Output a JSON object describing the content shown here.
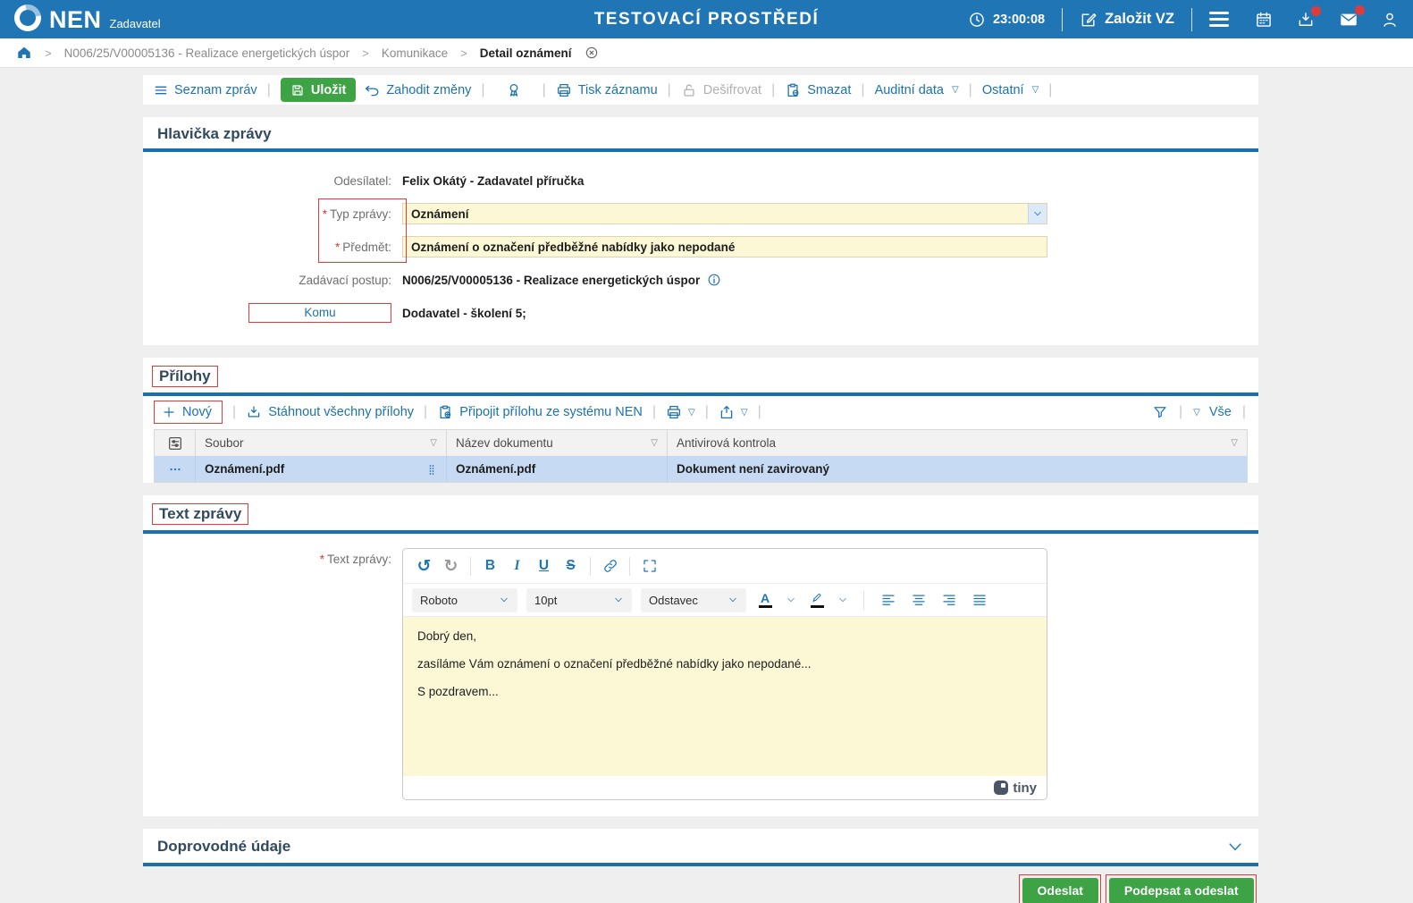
{
  "header": {
    "brand": "NEN",
    "brand_sub": "Zadavatel",
    "env": "TESTOVACÍ PROSTŘEDÍ",
    "time": "23:00:08",
    "zalozit": "Založit VZ"
  },
  "breadcrumb": {
    "item1": "N006/25/V00005136 - Realizace energetických úspor",
    "item2": "Komunikace",
    "item3": "Detail oznámení"
  },
  "toolbar": {
    "seznam": "Seznam zpráv",
    "ulozit": "Uložit",
    "zahodit": "Zahodit změny",
    "tisk": "Tisk záznamu",
    "desifrovat": "Dešifrovat",
    "smazat": "Smazat",
    "auditni": "Auditní data",
    "ostatni": "Ostatní"
  },
  "hlavicka": {
    "title": "Hlavička zprávy",
    "required_mark": "*",
    "odesilatel_label": "Odesílatel:",
    "odesilatel_value": "Felix Okátý - Zadavatel příručka",
    "typ_label": "Typ zprávy:",
    "typ_value": "Oznámení",
    "predmet_label": "Předmět:",
    "predmet_value": "Oznámení o označení předběžné nabídky jako nepodané",
    "postup_label": "Zadávací postup:",
    "postup_value": "N006/25/V00005136 - Realizace energetických úspor",
    "komu_label": "Komu",
    "komu_value": "Dodavatel - školení 5;"
  },
  "prilohy": {
    "title": "Přílohy",
    "novy": "Nový",
    "stahnout": "Stáhnout všechny přílohy",
    "pripojit": "Připojit přílohu ze systému NEN",
    "vse": "Vše",
    "col_soubor": "Soubor",
    "col_nazev": "Název dokumentu",
    "col_antivir": "Antivirová kontrola",
    "row": {
      "soubor": "Oznámení.pdf",
      "nazev": "Oznámení.pdf",
      "antivir": "Dokument není zavirovaný"
    }
  },
  "text_zpravy": {
    "title": "Text zprávy",
    "required_mark": "*",
    "label": "Text zprávy:",
    "editor": {
      "undo": "↺",
      "redo": "↻",
      "bold": "B",
      "italic": "I",
      "underline": "U",
      "strike": "S",
      "font": "Roboto",
      "size": "10pt",
      "block": "Odstavec",
      "color_letter": "A",
      "line1": "Dobrý den,",
      "line2": "zasíláme Vám oznámení o označení předběžné nabídky jako nepodané...",
      "line3": "S pozdravem...",
      "brand": "tiny"
    }
  },
  "doprovodne": {
    "title": "Doprovodné údaje"
  },
  "footer": {
    "odeslat": "Odeslat",
    "podepsat": "Podepsat a odeslat"
  },
  "icons": {
    "triangle_down": "▽"
  },
  "colors": {
    "header_blue": "#2076b5",
    "link_blue": "#1c72ae",
    "underline_blue": "#1a6fad",
    "green": "#3ea345",
    "field_yellow": "#fcf8d6",
    "section_navy": "#324a5e",
    "annotation_red": "#e03b3b",
    "selected_row_blue": "#c7daf3",
    "badge_red": "#e03b3b"
  }
}
